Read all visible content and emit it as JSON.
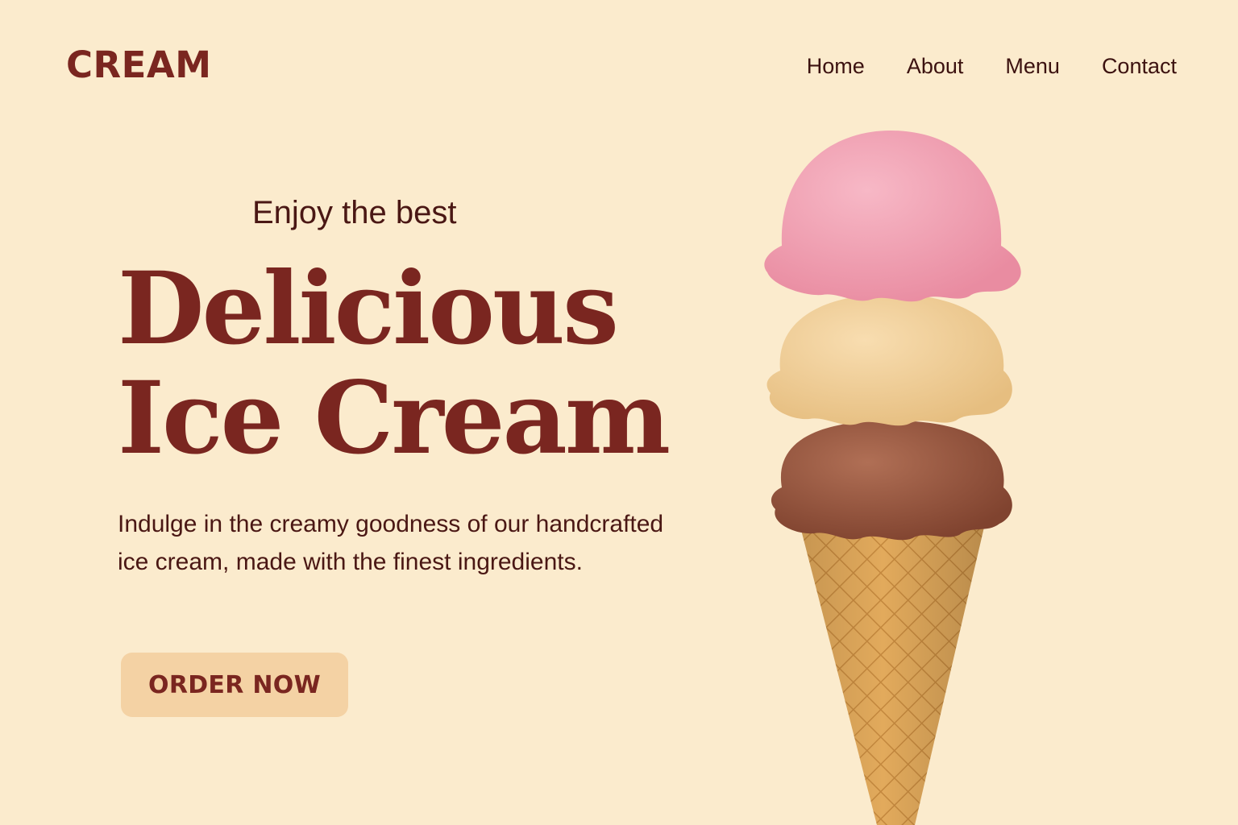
{
  "brand": {
    "logo_text": "CREAM"
  },
  "nav": {
    "items": [
      {
        "label": "Home"
      },
      {
        "label": "About"
      },
      {
        "label": "Menu"
      },
      {
        "label": "Contact"
      }
    ]
  },
  "hero": {
    "eyebrow": "Enjoy the best",
    "headline_line1": "Delicious",
    "headline_line2": "Ice Cream",
    "description": "Indulge in the creamy goodness of our handcrafted ice cream, made with the finest ingredients.",
    "cta_label": "ORDER NOW"
  },
  "colors": {
    "background": "#FBEBCD",
    "brand": "#7A2620",
    "text": "#4A1714",
    "button": "#F4D2A4",
    "scoop_strawberry": "#F2A1B2",
    "scoop_vanilla": "#F3D29E",
    "scoop_chocolate": "#9A5A45",
    "cone": "#E2AA5C"
  },
  "image": {
    "subject": "ice-cream-cone-three-scoops",
    "scoops": [
      "strawberry",
      "vanilla",
      "chocolate"
    ]
  }
}
